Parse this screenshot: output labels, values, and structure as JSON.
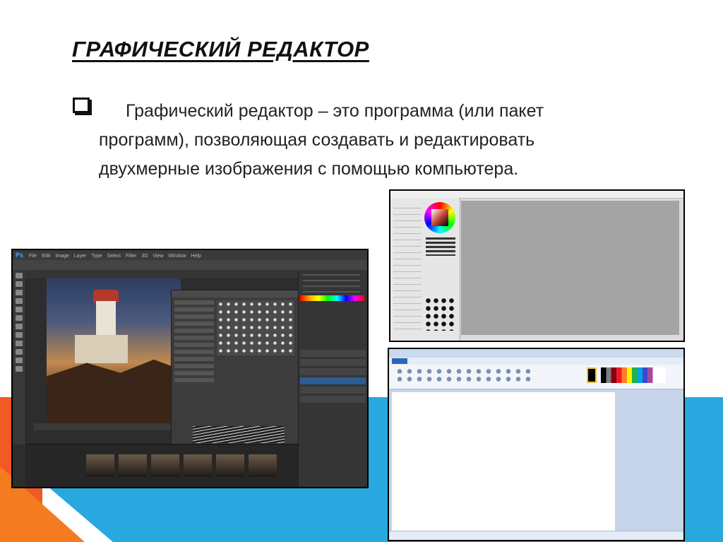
{
  "slide": {
    "title": "ГРАФИЧЕСКИЙ РЕДАКТОР",
    "definition": {
      "term": "Графический редактор",
      "text": " – это программа (или пакет программ), позволяющая создавать и редактировать двухмерные изображения с помощью компьютера."
    }
  },
  "colors": {
    "accent_orange": "#f15a22",
    "accent_blue": "#28a8de"
  },
  "screenshots": {
    "photoshop": {
      "app_icon": "Ps",
      "menu": [
        "File",
        "Edit",
        "Image",
        "Layer",
        "Type",
        "Select",
        "Filter",
        "3D",
        "View",
        "Window",
        "Help"
      ]
    },
    "paint_tool_sai": {},
    "ms_paint": {}
  }
}
